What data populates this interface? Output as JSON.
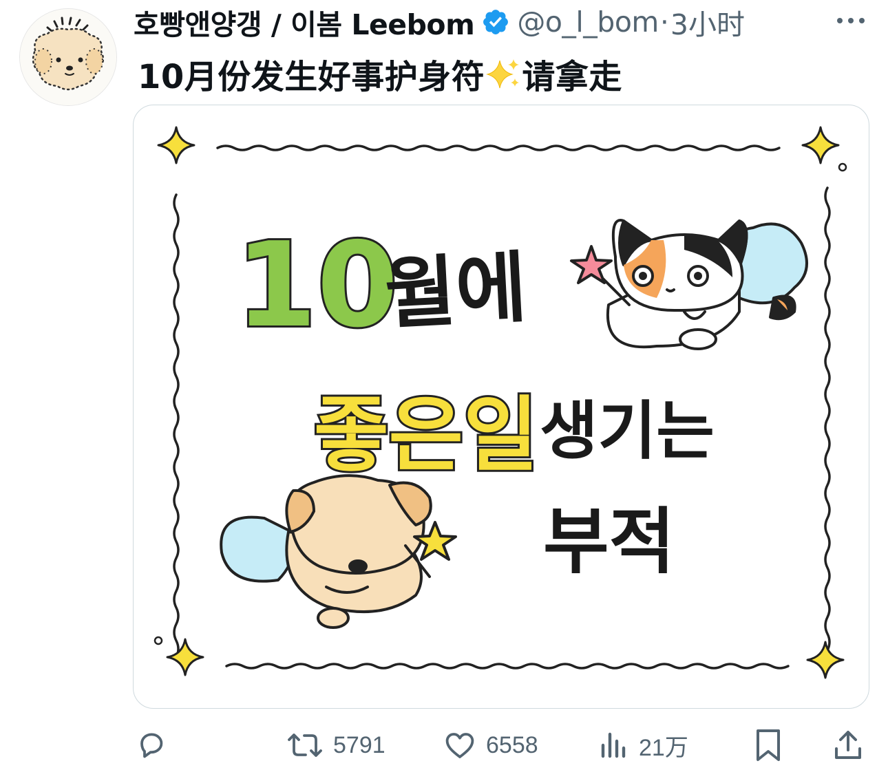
{
  "tweet": {
    "author": {
      "display_name": "호빵앤양갱 / 이봄 Leebom",
      "handle": "@o_l_bom",
      "verified": true,
      "avatar_icon": "puppy-avatar-icon"
    },
    "separator": "·",
    "time": "3小时",
    "text_before_emoji": "10月份发生好事护身符",
    "emoji": "sparkles",
    "text_after_emoji": "请拿走",
    "image": {
      "line1_number": "10",
      "line1_word": "월에",
      "line2_highlight": "좋은일",
      "line2_word": "생기는",
      "line3_word": "부적"
    },
    "actions": {
      "reply_icon": "reply-icon",
      "retweet_icon": "retweet-icon",
      "retweet_count": "5791",
      "like_icon": "heart-icon",
      "like_count": "6558",
      "views_icon": "views-icon",
      "views_count": "21万",
      "bookmark_icon": "bookmark-icon",
      "share_icon": "share-icon"
    }
  },
  "colors": {
    "text_primary": "#0f1419",
    "text_secondary": "#536471",
    "verified_blue": "#1d9bf0",
    "green": "#8cc84b",
    "yellow": "#f7df3c",
    "wing_blue": "#c6ecf7",
    "dog_tan": "#f8dfb9",
    "dog_ear": "#f0c083",
    "cat_orange": "#f5a55a"
  }
}
